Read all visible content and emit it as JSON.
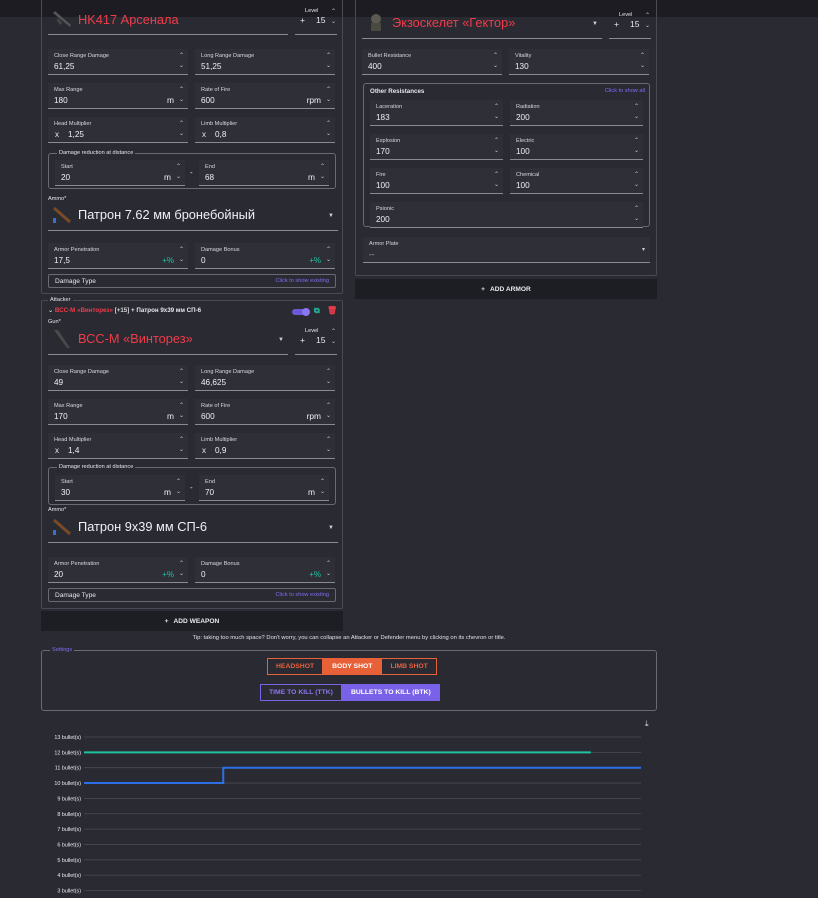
{
  "defender_weapon": {
    "name": "HK417 Арсенала",
    "level_label": "Level",
    "level_value": "15",
    "close_dmg_label": "Close Range Damage",
    "close_dmg": "61,25",
    "long_dmg_label": "Long Range Damage",
    "long_dmg": "51,25",
    "max_range_label": "Max Range",
    "max_range": "180",
    "max_range_unit": "m",
    "rof_label": "Rate of Fire",
    "rof": "600",
    "rof_unit": "rpm",
    "head_label": "Head Multiplier",
    "head": "1,25",
    "limb_label": "Limb Multiplier",
    "limb": "0,8",
    "reduction_label": "Damage reduction at distance",
    "start_label": "Start",
    "start": "20",
    "start_unit": "m",
    "end_label": "End",
    "end": "68",
    "end_unit": "m",
    "ammo_label": "Ammo*",
    "ammo": "Патрон 7.62 мм бронебойный",
    "pen_label": "Armor Penetration",
    "pen": "17,5",
    "pen_unit": "+%",
    "bonus_label": "Damage Bonus",
    "bonus": "0",
    "bonus_unit": "+%",
    "dtype_label": "Damage Type",
    "dtype_hint": "Click to show existing"
  },
  "attacker": {
    "section_label": "Attacker",
    "summary_weapon": "ВСС-М «Винторез»",
    "summary_level": "[+15]",
    "summary_ammo": "+ Патрон 9х39 мм СП-6",
    "gun_label": "Gun*",
    "name": "ВСС-М «Винторез»",
    "level_label": "Level",
    "level_value": "15",
    "close_dmg_label": "Close Range Damage",
    "close_dmg": "49",
    "long_dmg_label": "Long Range Damage",
    "long_dmg": "46,625",
    "max_range_label": "Max Range",
    "max_range": "170",
    "max_range_unit": "m",
    "rof_label": "Rate of Fire",
    "rof": "600",
    "rof_unit": "rpm",
    "head_label": "Head Multiplier",
    "head": "1,4",
    "limb_label": "Limb Multiplier",
    "limb": "0,9",
    "reduction_label": "Damage reduction at distance",
    "start_label": "Start",
    "start": "30",
    "start_unit": "m",
    "end_label": "End",
    "end": "70",
    "end_unit": "m",
    "ammo_label": "Ammo*",
    "ammo": "Патрон 9х39 мм СП-6",
    "pen_label": "Armor Penetration",
    "pen": "20",
    "pen_unit": "+%",
    "bonus_label": "Damage Bonus",
    "bonus": "0",
    "bonus_unit": "+%",
    "dtype_label": "Damage Type",
    "dtype_hint": "Click to show existing"
  },
  "add_weapon_label": "ADD WEAPON",
  "armor": {
    "name": "Экзоскелет «Гектор»",
    "level_label": "Level",
    "level_value": "15",
    "bullet_res_label": "Bullet Resistance",
    "bullet_res": "400",
    "vitality_label": "Vitality",
    "vitality": "130",
    "other_label": "Other Resistances",
    "other_hint": "Click to show all",
    "laceration_label": "Laceration",
    "laceration": "183",
    "radiation_label": "Radiation",
    "radiation": "200",
    "explosion_label": "Explosion",
    "explosion": "170",
    "electric_label": "Electric",
    "electric": "100",
    "fire_label": "Fire",
    "fire": "100",
    "chemical_label": "Chemical",
    "chemical": "100",
    "psionic_label": "Psionic",
    "psionic": "200",
    "plate_label": "Armor Plate",
    "plate": "--"
  },
  "add_armor_label": "ADD ARMOR",
  "tip": "Tip: taking too much space? Don't worry, you can collapse an Attacker or Defender menu by clicking on its chevron or title.",
  "settings": {
    "label": "Settings",
    "shot_tabs": [
      "HEADSHOT",
      "BODY SHOT",
      "LIMB SHOT"
    ],
    "shot_selected": 1,
    "mode_tabs": [
      "TIME TO KILL (TTK)",
      "BULLETS TO KILL (BTK)"
    ],
    "mode_selected": 1
  },
  "colors": {
    "accent_red": "#f03c49",
    "accent_orange": "#e86038",
    "accent_purple": "#7a62e8",
    "teal": "#21c2a0",
    "blue": "#2d6fe6"
  },
  "chart_data": {
    "type": "line",
    "y_ticks": [
      "13 bullet(s)",
      "12 bullet(s)",
      "11 bullet(s)",
      "10 bullet(s)",
      "9 bullet(s)",
      "8 bullet(s)",
      "7 bullet(s)",
      "6 bullet(s)",
      "5 bullet(s)",
      "4 bullet(s)",
      "3 bullet(s)"
    ],
    "ylim": [
      3,
      13
    ],
    "xlim": [
      0,
      100
    ],
    "grid": true,
    "series": [
      {
        "color": "#21c2a0",
        "x": [
          0,
          91
        ],
        "y": [
          12,
          12
        ],
        "step": true
      },
      {
        "color": "#2d6fe6",
        "x": [
          0,
          25,
          25,
          100
        ],
        "y": [
          10,
          10,
          11,
          11
        ],
        "step": true
      }
    ]
  }
}
